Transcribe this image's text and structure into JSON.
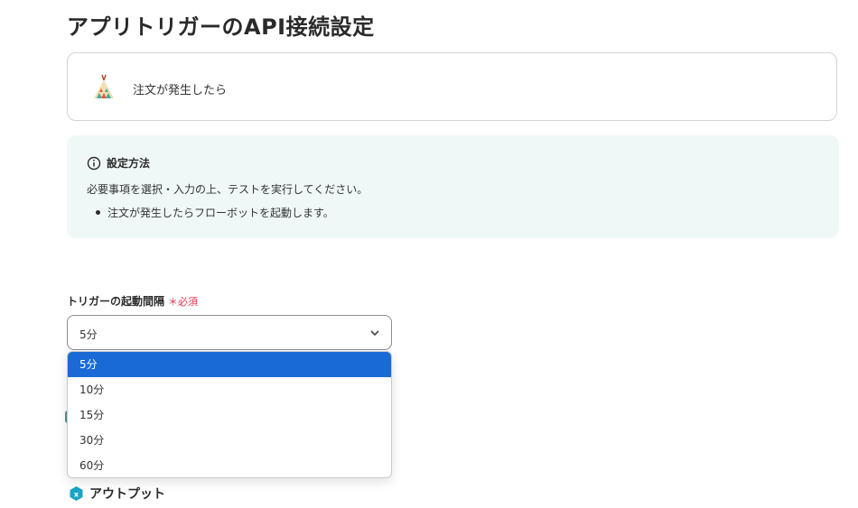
{
  "page": {
    "title": "アプリトリガーのAPI接続設定"
  },
  "trigger": {
    "name": "注文が発生したら",
    "logo_icon": "teepee-logo-icon"
  },
  "info": {
    "title": "設定方法",
    "description": "必要事項を選択・入力の上、テストを実行してください。",
    "items": [
      "注文が発生したらフローボットを起動します。"
    ],
    "background": "#eff8f7"
  },
  "interval_field": {
    "label": "トリガーの起動間隔",
    "required_label": "＊必須",
    "selected_value": "5分",
    "options": [
      "5分",
      "10分",
      "15分",
      "30分",
      "60分"
    ],
    "selected_index": 0,
    "selected_color": "#1a6ad6"
  },
  "output": {
    "title": "アウトプット",
    "icon": "output-hexagon-icon",
    "icon_color": "#17a6c4"
  }
}
